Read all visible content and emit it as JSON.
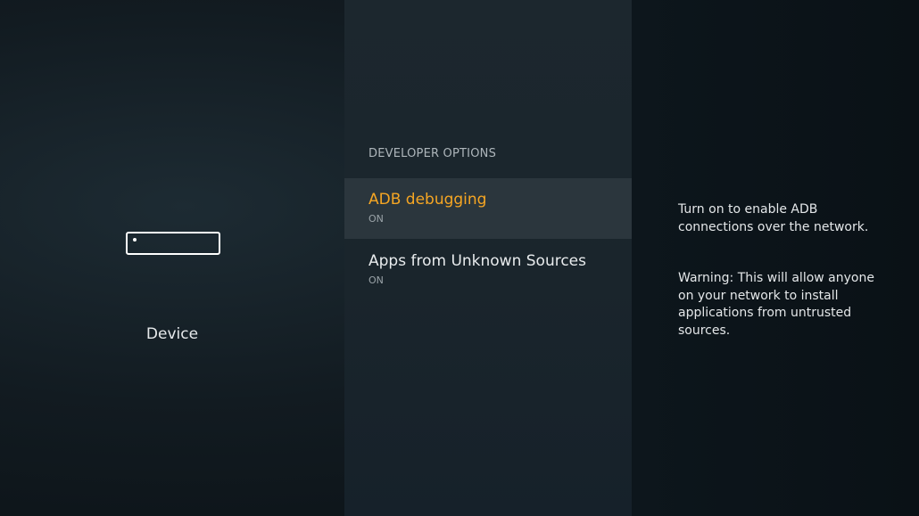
{
  "left_panel": {
    "device_label": "Device",
    "icon": "fire-tv-stick-icon"
  },
  "menu": {
    "section_header": "DEVELOPER OPTIONS",
    "items": [
      {
        "title": "ADB debugging",
        "value": "ON",
        "selected": true
      },
      {
        "title": "Apps from Unknown Sources",
        "value": "ON",
        "selected": false
      }
    ]
  },
  "description": {
    "paragraph1": "Turn on to enable ADB connections over the network.",
    "paragraph2": "Warning: This will allow anyone on your network to install applications from untrusted sources."
  },
  "colors": {
    "accent": "#f6a623",
    "selected_bg": "#2b363d",
    "text": "#e8ebed"
  }
}
